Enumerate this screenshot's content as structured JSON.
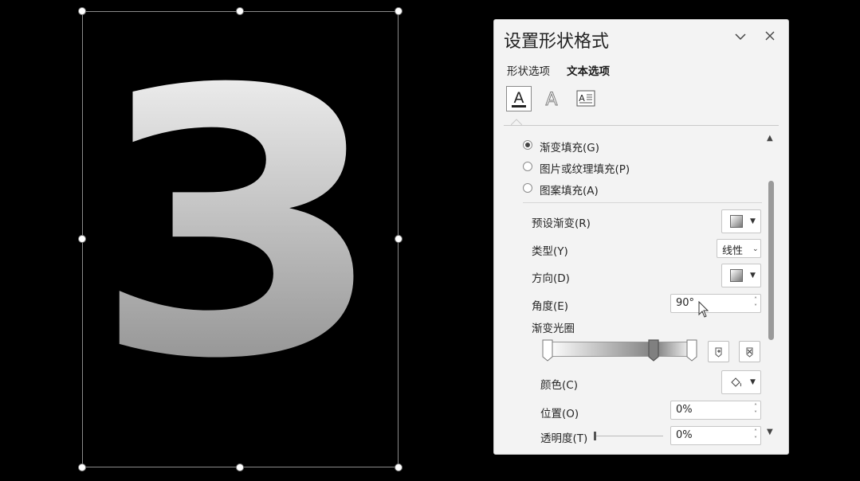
{
  "slide": {
    "glyph_text": "3",
    "glyph_gradient": {
      "top_color": "#ffffff",
      "bottom_color": "#7f7f7f"
    }
  },
  "pane": {
    "title": "设置形状格式",
    "tabs": [
      {
        "label": "形状选项",
        "active": false
      },
      {
        "label": "文本选项",
        "active": true
      }
    ],
    "icon_tabs": [
      "text-fill-outline-icon",
      "text-effects-icon",
      "textbox-icon"
    ],
    "fill_options": [
      {
        "label": "渐变填充(G)",
        "selected": true
      },
      {
        "label": "图片或纹理填充(P)",
        "selected": false
      },
      {
        "label": "图案填充(A)",
        "selected": false
      }
    ],
    "preset_gradient_label": "预设渐变(R)",
    "type_label": "类型(Y)",
    "type_value": "线性",
    "direction_label": "方向(D)",
    "angle_label": "角度(E)",
    "angle_value": "90°",
    "gradient_stops_label": "渐变光圈",
    "gradient_stops": [
      {
        "position": 0.0,
        "selected": false
      },
      {
        "position": 0.74,
        "selected": true
      },
      {
        "position": 1.0,
        "selected": false
      }
    ],
    "color_label": "颜色(C)",
    "position_label": "位置(O)",
    "position_value": "0%",
    "transparency_label": "透明度(T)",
    "transparency_value": "0%"
  },
  "colors": {
    "pane_bg": "#f3f3f3",
    "slide_bg": "#000000"
  }
}
